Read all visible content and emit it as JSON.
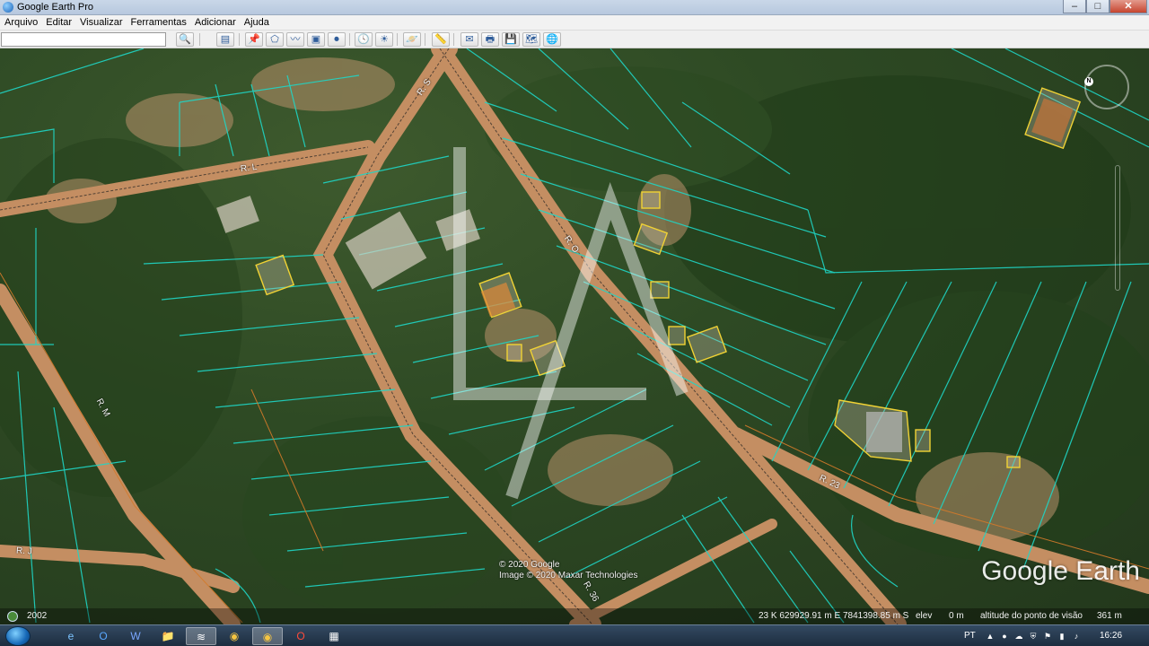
{
  "window": {
    "title": "Google Earth Pro",
    "minimize": "–",
    "maximize": "□",
    "close": "✕"
  },
  "menu": [
    "Arquivo",
    "Editar",
    "Visualizar",
    "Ferramentas",
    "Adicionar",
    "Ajuda"
  ],
  "toolbar": {
    "search_placeholder": "",
    "buttons": [
      {
        "name": "search-icon",
        "glyph": "🔍"
      },
      {
        "name": "sidebar-toggle-icon",
        "glyph": "▤"
      },
      {
        "name": "add-placemark-icon",
        "glyph": "📌"
      },
      {
        "name": "add-polygon-icon",
        "glyph": "⬠"
      },
      {
        "name": "add-path-icon",
        "glyph": "〰"
      },
      {
        "name": "add-image-overlay-icon",
        "glyph": "▣"
      },
      {
        "name": "record-tour-icon",
        "glyph": "⏺"
      },
      {
        "name": "historical-imagery-icon",
        "glyph": "🕓"
      },
      {
        "name": "sunlight-icon",
        "glyph": "☀"
      },
      {
        "name": "planets-icon",
        "glyph": "🪐"
      },
      {
        "name": "ruler-icon",
        "glyph": "📏"
      },
      {
        "name": "email-icon",
        "glyph": "✉"
      },
      {
        "name": "print-icon",
        "glyph": "🖶"
      },
      {
        "name": "save-image-icon",
        "glyph": "💾"
      },
      {
        "name": "view-in-maps-icon",
        "glyph": "🗺"
      },
      {
        "name": "earth-icon",
        "glyph": "🌐"
      }
    ]
  },
  "map": {
    "road_labels": [
      {
        "text": "R. S"
      },
      {
        "text": "R. L"
      },
      {
        "text": "R. O"
      },
      {
        "text": "R. M"
      },
      {
        "text": "R. 23"
      },
      {
        "text": "R. J"
      },
      {
        "text": "R. 36"
      }
    ],
    "compass_letter": "N",
    "copyright_lines": [
      "© 2020 Google",
      "Image © 2020 Maxar Technologies"
    ],
    "logo": "Google Earth"
  },
  "status": {
    "year": "2002",
    "coords": "23 K 629929.91 m E 7841398.85 m S",
    "elev_label": "elev",
    "elev_value": "0 m",
    "alt_label": "altitude do ponto de visão",
    "alt_value": "361 m"
  },
  "taskbar": {
    "apps": [
      {
        "name": "ie-icon",
        "glyph": "e"
      },
      {
        "name": "outlook-icon",
        "glyph": "O"
      },
      {
        "name": "word-icon",
        "glyph": "W"
      },
      {
        "name": "explorer-icon",
        "glyph": "📁"
      },
      {
        "name": "google-earth-task-icon",
        "glyph": "≋"
      },
      {
        "name": "chrome-icon",
        "glyph": "◉"
      },
      {
        "name": "chrome-alt-icon",
        "glyph": "◉"
      },
      {
        "name": "opera-icon",
        "glyph": "O"
      },
      {
        "name": "calculator-icon",
        "glyph": "▦"
      }
    ],
    "lang": "PT",
    "time": "16:26"
  },
  "colors": {
    "parcel_line": "#1fd6c6",
    "house_outline": "#f0d234",
    "road": "#c78a5a"
  }
}
